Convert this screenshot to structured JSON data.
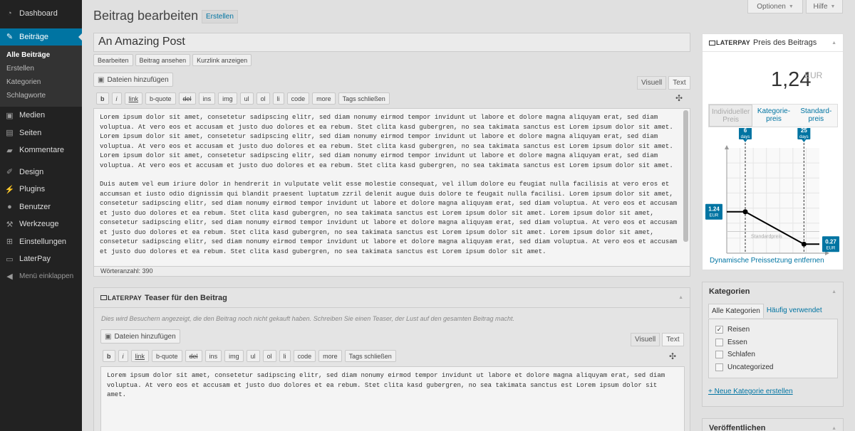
{
  "sidebar": {
    "items": [
      {
        "label": "Dashboard",
        "icon": "dashboard-icon"
      },
      {
        "label": "Beiträge",
        "icon": "pin-icon"
      },
      {
        "label": "Medien",
        "icon": "media-icon"
      },
      {
        "label": "Seiten",
        "icon": "pages-icon"
      },
      {
        "label": "Kommentare",
        "icon": "comment-icon"
      },
      {
        "label": "Design",
        "icon": "brush-icon"
      },
      {
        "label": "Plugins",
        "icon": "plugin-icon"
      },
      {
        "label": "Benutzer",
        "icon": "user-icon"
      },
      {
        "label": "Werkzeuge",
        "icon": "wrench-icon"
      },
      {
        "label": "Einstellungen",
        "icon": "settings-icon"
      },
      {
        "label": "LaterPay",
        "icon": "laterpay-icon"
      }
    ],
    "submenu": [
      "Alle Beiträge",
      "Erstellen",
      "Kategorien",
      "Schlagworte"
    ],
    "collapse_label": "Menü einklappen"
  },
  "header": {
    "title": "Beitrag bearbeiten",
    "create_label": "Erstellen",
    "options_label": "Optionen",
    "help_label": "Hilfe"
  },
  "editor": {
    "post_title": "An Amazing Post",
    "permalink_buttons": [
      "Bearbeiten",
      "Beitrag ansehen",
      "Kurzlink anzeigen"
    ],
    "add_media_label": "Dateien hinzufügen",
    "tab_visual": "Visuell",
    "tab_text": "Text",
    "toolbar": [
      "b",
      "i",
      "link",
      "b-quote",
      "del",
      "ins",
      "img",
      "ul",
      "ol",
      "li",
      "code",
      "more",
      "Tags schließen"
    ],
    "paragraph_1": "Lorem ipsum dolor sit amet, consetetur sadipscing elitr, sed diam nonumy eirmod tempor invidunt ut labore et dolore magna aliquyam erat, sed diam voluptua. At vero eos et accusam et justo duo dolores et ea rebum. Stet clita kasd gubergren, no sea takimata sanctus est Lorem ipsum dolor sit amet. Lorem ipsum dolor sit amet, consetetur sadipscing elitr, sed diam nonumy eirmod tempor invidunt ut labore et dolore magna aliquyam erat, sed diam voluptua. At vero eos et accusam et justo duo dolores et ea rebum. Stet clita kasd gubergren, no sea takimata sanctus est Lorem ipsum dolor sit amet. Lorem ipsum dolor sit amet, consetetur sadipscing elitr, sed diam nonumy eirmod tempor invidunt ut labore et dolore magna aliquyam erat, sed diam voluptua. At vero eos et accusam et justo duo dolores et ea rebum. Stet clita kasd gubergren, no sea takimata sanctus est Lorem ipsum dolor sit amet.",
    "paragraph_2": "Duis autem vel eum iriure dolor in hendrerit in vulputate velit esse molestie consequat, vel illum dolore eu feugiat nulla facilisis at vero eros et accumsan et iusto odio dignissim qui blandit praesent luptatum zzril delenit augue duis dolore te feugait nulla facilisi. Lorem ipsum dolor sit amet, consetetur sadipscing elitr, sed diam nonumy eirmod tempor invidunt ut labore et dolore magna aliquyam erat, sed diam voluptua. At vero eos et accusam et justo duo dolores et ea rebum. Stet clita kasd gubergren, no sea takimata sanctus est Lorem ipsum dolor sit amet. Lorem ipsum dolor sit amet, consetetur sadipscing elitr, sed diam nonumy eirmod tempor invidunt ut labore et dolore magna aliquyam erat, sed diam voluptua. At vero eos et accusam et justo duo dolores et ea rebum. Stet clita kasd gubergren, no sea takimata sanctus est Lorem ipsum dolor sit amet. Lorem ipsum dolor sit amet, consetetur sadipscing elitr, sed diam nonumy eirmod tempor invidunt ut labore et dolore magna aliquyam erat, sed diam voluptua. At vero eos et accusam et justo duo dolores et ea rebum. Stet clita kasd gubergren, no sea takimata sanctus est Lorem ipsum dolor sit amet.",
    "word_count": "Wörteranzahl: 390"
  },
  "teaser": {
    "brand": "LATERPAY",
    "title": "Teaser für den Beitrag",
    "hint": "Dies wird Besuchern angezeigt, die den Beitrag noch nicht gekauft haben. Schreiben Sie einen Teaser, der Lust auf den gesamten Beitrag macht.",
    "add_media_label": "Dateien hinzufügen",
    "tab_visual": "Visuell",
    "tab_text": "Text",
    "text": "Lorem ipsum dolor sit amet, consetetur sadipscing elitr, sed diam nonumy eirmod tempor invidunt ut labore et dolore magna aliquyam erat, sed diam voluptua. At vero eos et accusam et justo duo dolores et ea rebum. Stet clita kasd gubergren, no sea takimata sanctus est Lorem ipsum dolor sit amet."
  },
  "price_box": {
    "brand": "LATERPAY",
    "title": "Preis des Beitrags",
    "price": "1,24",
    "currency": "EUR",
    "tabs": [
      "Individueller Preis",
      "Kategorie-preis",
      "Standard-preis"
    ],
    "remove_link": "Dynamische Preissetzung entfernen"
  },
  "chart_data": {
    "type": "line",
    "x": [
      0,
      6,
      25,
      30
    ],
    "y": [
      1.24,
      1.24,
      0.27,
      0.27
    ],
    "markers": [
      {
        "label": "6",
        "unit": "days",
        "x": 6
      },
      {
        "label": "25",
        "unit": "days",
        "x": 25
      }
    ],
    "start_label": "1.24",
    "end_label": "0.27",
    "currency": "EUR",
    "reference_label": "Standardpreis",
    "xlim": [
      0,
      30
    ],
    "ylim": [
      0,
      2
    ],
    "grid": true,
    "line_color": "#000000",
    "marker_color": "#0074a2"
  },
  "categories": {
    "title": "Kategorien",
    "tab_all": "Alle Kategorien",
    "tab_popular": "Häufig verwendet",
    "items": [
      {
        "label": "Reisen",
        "checked": true
      },
      {
        "label": "Essen",
        "checked": false
      },
      {
        "label": "Schlafen",
        "checked": false
      },
      {
        "label": "Uncategorized",
        "checked": false
      }
    ],
    "add_link": "+ Neue Kategorie erstellen"
  },
  "publish": {
    "title": "Veröffentlichen"
  },
  "colors": {
    "accent": "#0074a2",
    "sidebar_bg": "#222222"
  }
}
